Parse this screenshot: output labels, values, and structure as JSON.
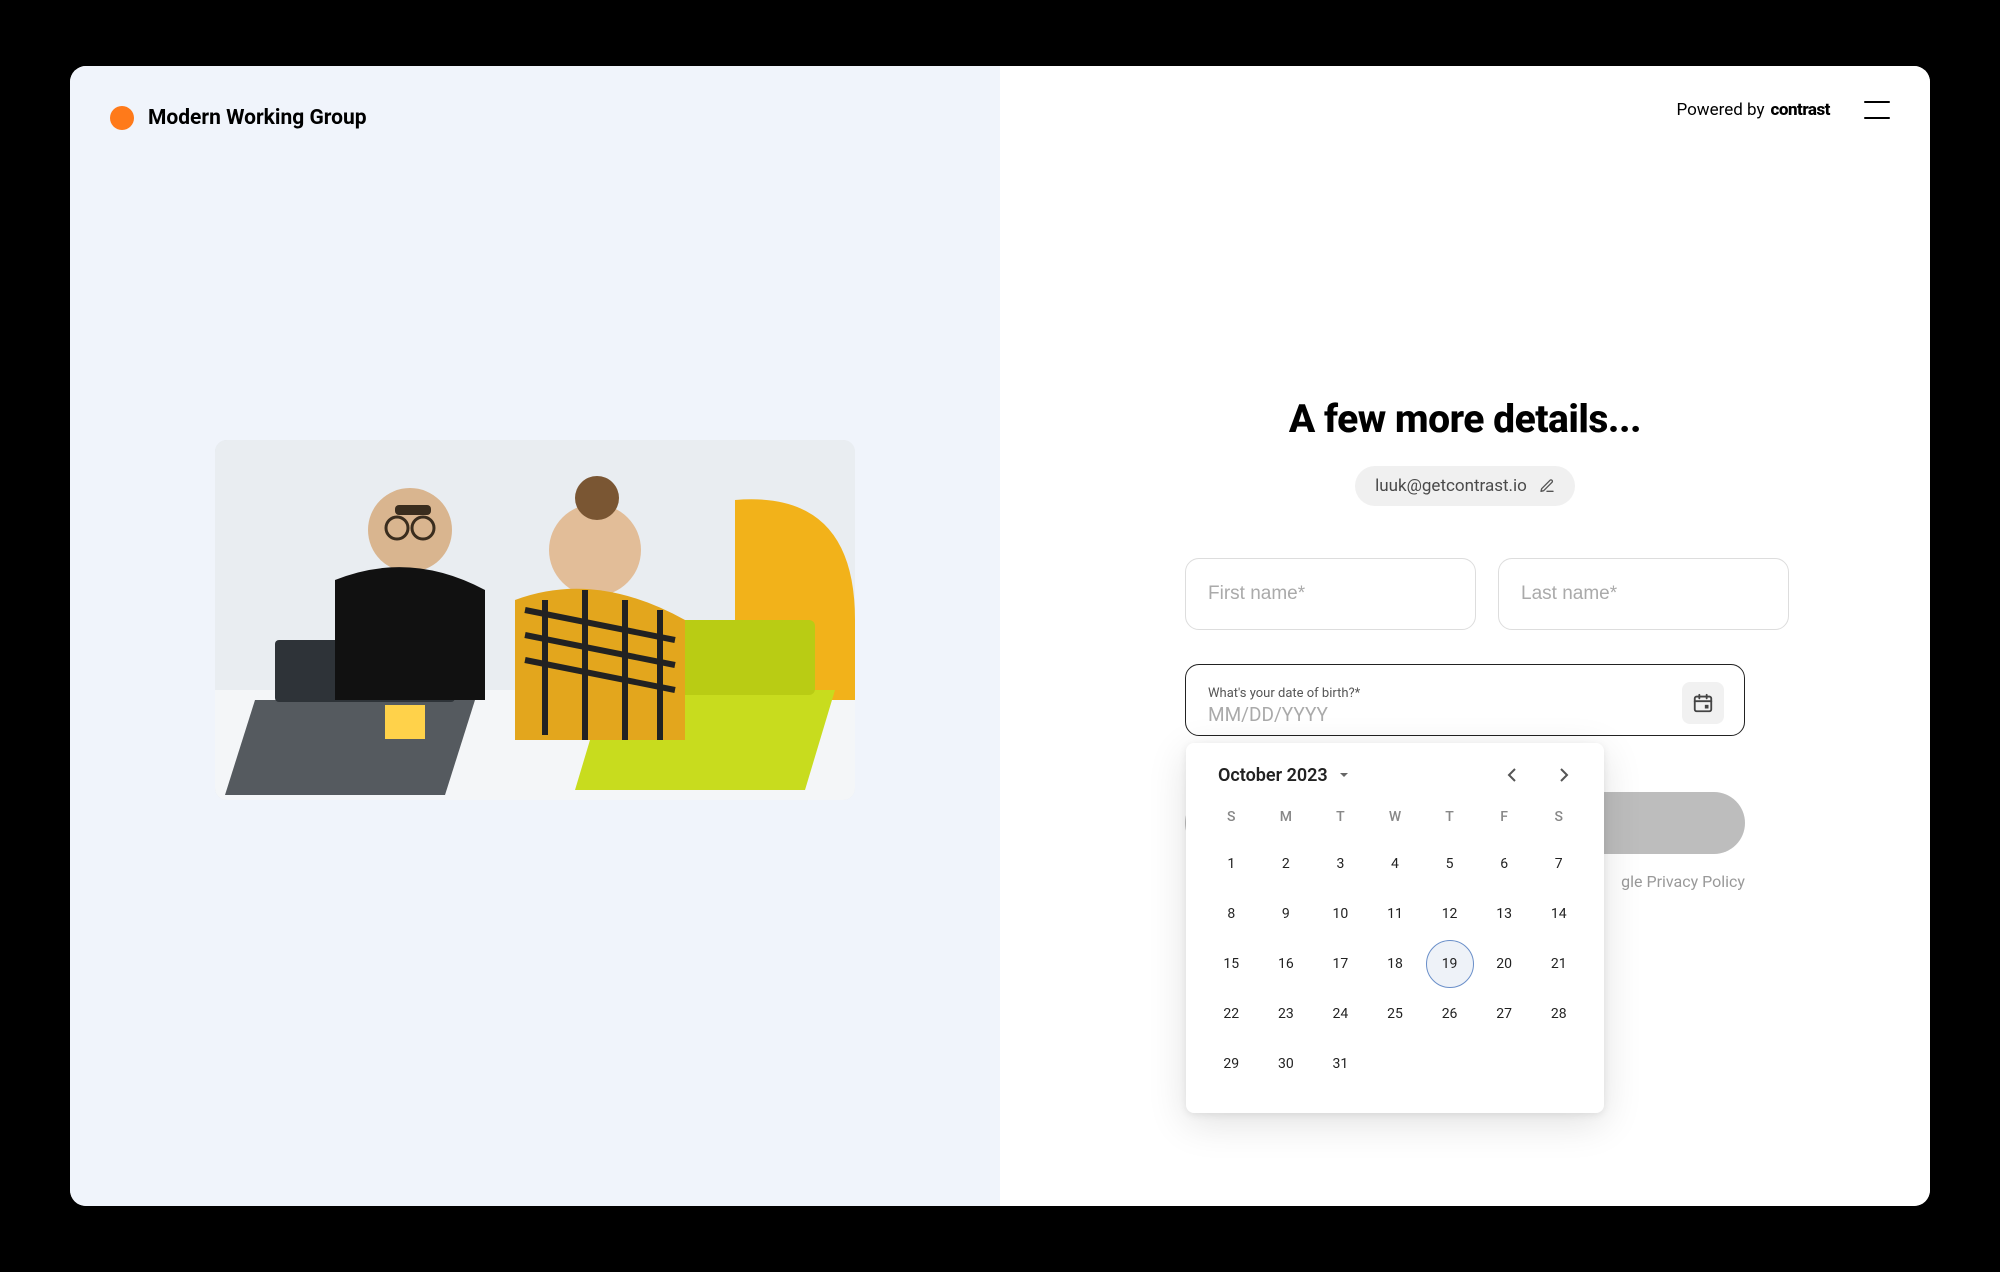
{
  "brand": {
    "name": "Modern Working Group"
  },
  "header": {
    "powered_by_label": "Powered by",
    "powered_by_brand": "contrast"
  },
  "form": {
    "title": "A few more details...",
    "email": "luuk@getcontrast.io",
    "first_name_placeholder": "First name*",
    "last_name_placeholder": "Last name*",
    "dob_label": "What's your date of birth?*",
    "dob_placeholder": "MM/DD/YYYY",
    "privacy_text": "gle Privacy Policy"
  },
  "calendar": {
    "month_label": "October 2023",
    "dow": [
      "S",
      "M",
      "T",
      "W",
      "T",
      "F",
      "S"
    ],
    "leading_blanks": 0,
    "days": 31,
    "today": 19
  }
}
